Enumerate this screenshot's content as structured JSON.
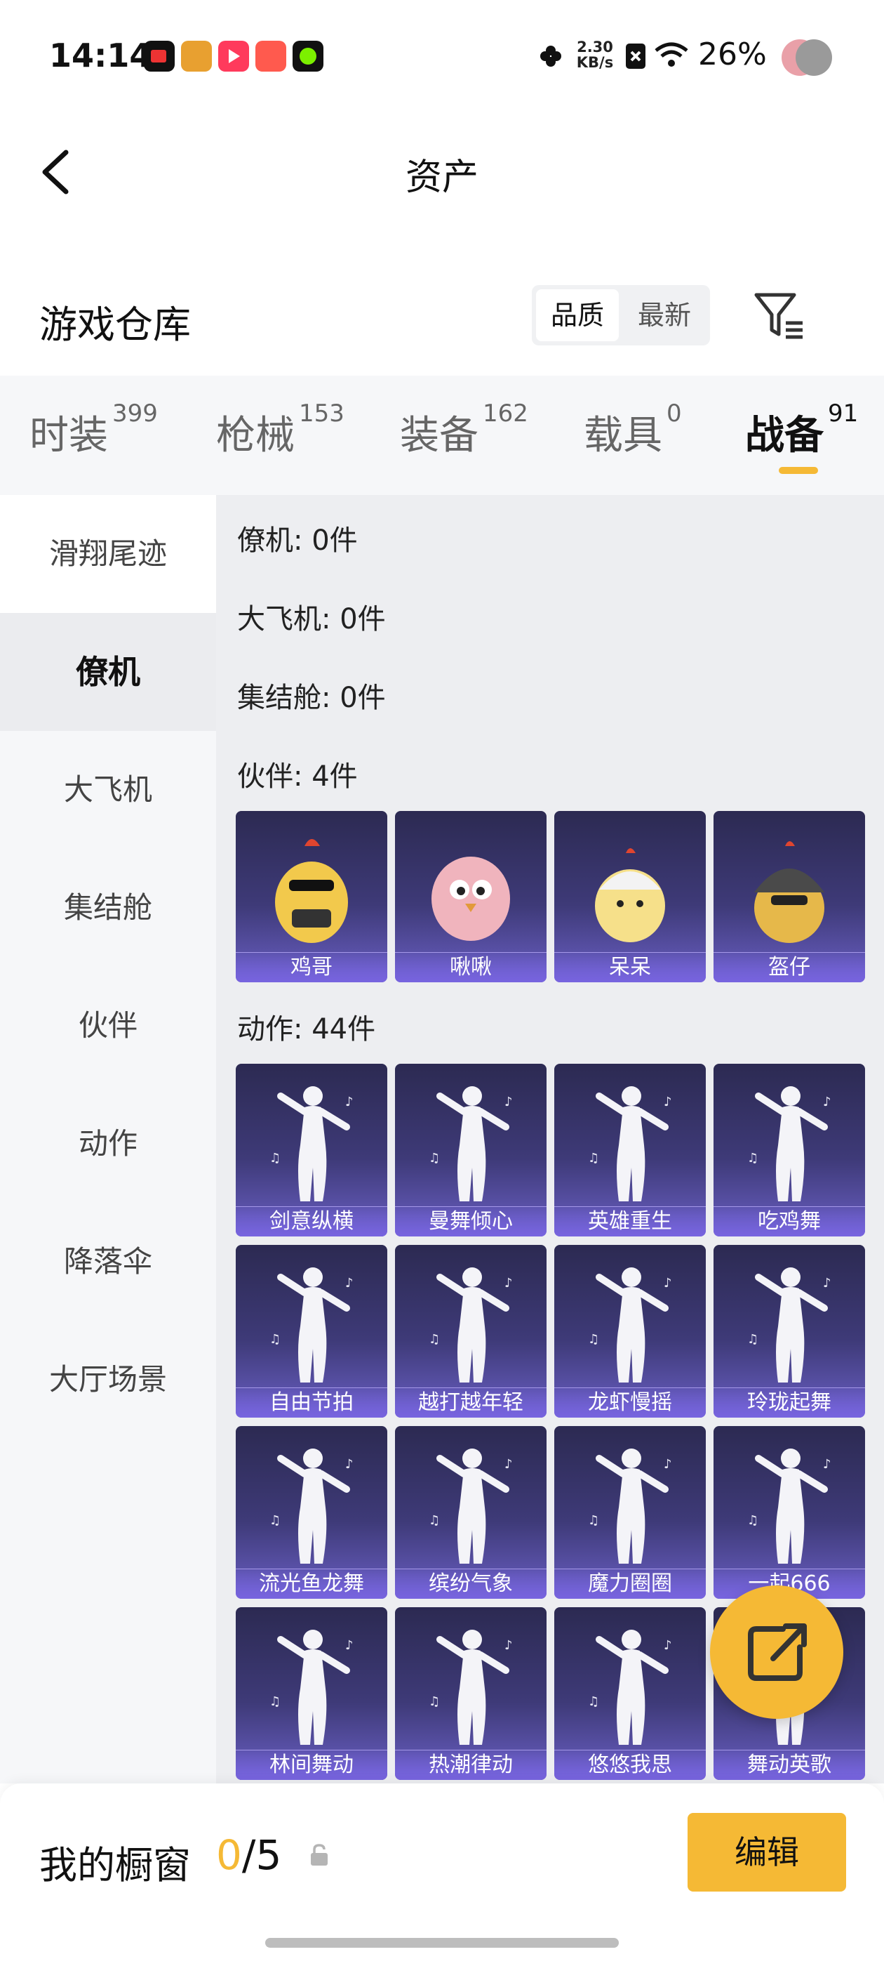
{
  "status_bar": {
    "time": "14:14",
    "net_speed_value": "2.30",
    "net_speed_unit": "KB/s",
    "battery": "26%"
  },
  "header": {
    "title": "资产"
  },
  "warehouse": {
    "title": "游戏仓库",
    "sort_quality": "品质",
    "sort_latest": "最新"
  },
  "tabs": [
    {
      "label": "时装",
      "count": "399"
    },
    {
      "label": "枪械",
      "count": "153"
    },
    {
      "label": "装备",
      "count": "162"
    },
    {
      "label": "载具",
      "count": "0"
    },
    {
      "label": "战备",
      "count": "91"
    }
  ],
  "sidebar": [
    {
      "label": "滑翔尾迹"
    },
    {
      "label": "僚机"
    },
    {
      "label": "大飞机"
    },
    {
      "label": "集结舱"
    },
    {
      "label": "伙伴"
    },
    {
      "label": "动作"
    },
    {
      "label": "降落伞"
    },
    {
      "label": "大厅场景"
    }
  ],
  "sections": {
    "wingman": "僚机: 0件",
    "plane": "大飞机: 0件",
    "pod": "集结舱: 0件",
    "partner": "伙伴: 4件",
    "emote": "动作: 44件"
  },
  "partners": [
    {
      "name": "鸡哥"
    },
    {
      "name": "啾啾"
    },
    {
      "name": "呆呆"
    },
    {
      "name": "盔仔"
    }
  ],
  "emotes": [
    {
      "name": "剑意纵横"
    },
    {
      "name": "曼舞倾心"
    },
    {
      "name": "英雄重生"
    },
    {
      "name": "吃鸡舞"
    },
    {
      "name": "自由节拍"
    },
    {
      "name": "越打越年轻"
    },
    {
      "name": "龙虾慢摇"
    },
    {
      "name": "玲珑起舞"
    },
    {
      "name": "流光鱼龙舞"
    },
    {
      "name": "缤纷气象"
    },
    {
      "name": "魔力圈圈"
    },
    {
      "name": "一起666"
    },
    {
      "name": "林间舞动"
    },
    {
      "name": "热潮律动"
    },
    {
      "name": "悠悠我思"
    },
    {
      "name": "舞动英歌"
    }
  ],
  "showcase": {
    "label": "我的橱窗",
    "current": "0",
    "total": "/5",
    "edit": "编辑"
  },
  "colors": {
    "accent": "#f5b935",
    "card_top": "#2c2a52",
    "card_bottom": "#6a5fc4"
  }
}
